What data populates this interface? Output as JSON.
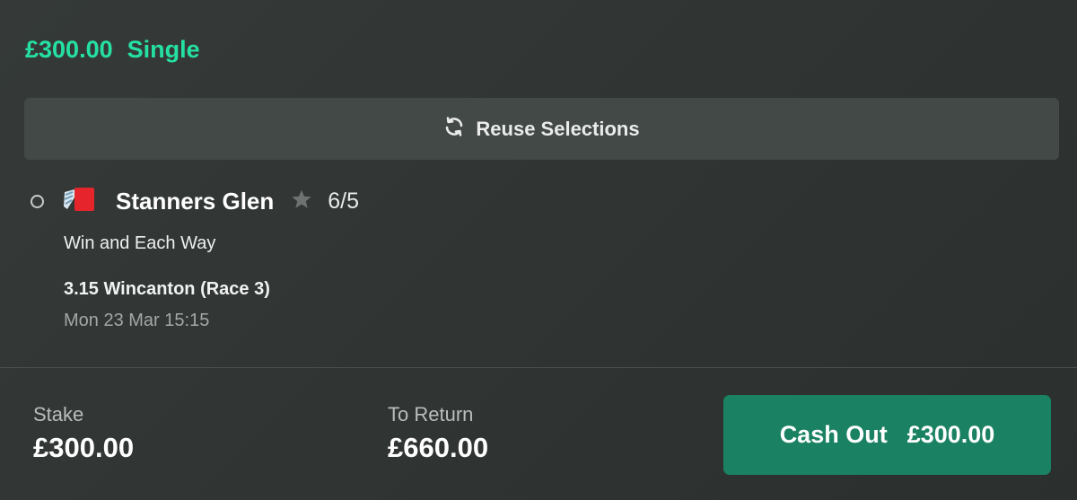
{
  "bet": {
    "amount": "£300.00",
    "type": "Single"
  },
  "reuse_button": {
    "icon": "refresh-icon",
    "label": "Reuse Selections"
  },
  "selection": {
    "icon": "jockey-silks-icon",
    "horse": "Stanners Glen",
    "odds": "6/5",
    "market": "Win and Each Way",
    "event": "3.15 Wincanton (Race 3)",
    "datetime": "Mon 23 Mar 15:15"
  },
  "footer": {
    "stake_label": "Stake",
    "stake_value": "£300.00",
    "return_label": "To Return",
    "return_value": "£660.00",
    "cashout_label": "Cash Out",
    "cashout_value": "£300.00"
  },
  "colors": {
    "accent_green": "#25e0a3",
    "cashout_button": "#1a8262",
    "silks_red": "#e5242b"
  }
}
